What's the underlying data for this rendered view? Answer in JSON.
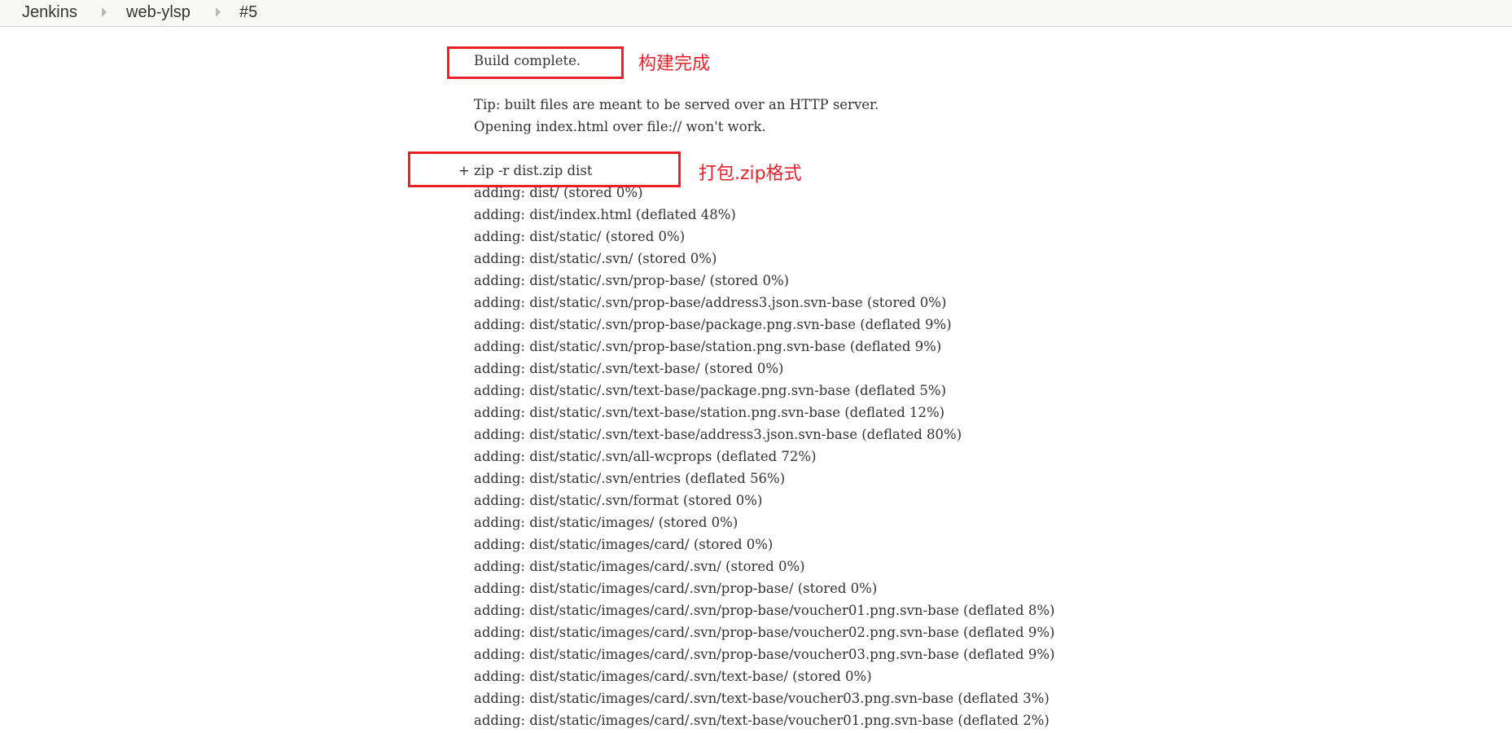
{
  "breadcrumb": {
    "items": [
      "Jenkins",
      "web-ylsp",
      "#5"
    ]
  },
  "console": {
    "build_complete": "Build complete.",
    "tip_lines": [
      "Tip: built files are meant to be served over an HTTP server.",
      "Opening index.html over file:// won't work."
    ],
    "zip_command": "+ zip -r dist.zip dist",
    "adding_lines": [
      "adding: dist/ (stored 0%)",
      "adding: dist/index.html (deflated 48%)",
      "adding: dist/static/ (stored 0%)",
      "adding: dist/static/.svn/ (stored 0%)",
      "adding: dist/static/.svn/prop-base/ (stored 0%)",
      "adding: dist/static/.svn/prop-base/address3.json.svn-base (stored 0%)",
      "adding: dist/static/.svn/prop-base/package.png.svn-base (deflated 9%)",
      "adding: dist/static/.svn/prop-base/station.png.svn-base (deflated 9%)",
      "adding: dist/static/.svn/text-base/ (stored 0%)",
      "adding: dist/static/.svn/text-base/package.png.svn-base (deflated 5%)",
      "adding: dist/static/.svn/text-base/station.png.svn-base (deflated 12%)",
      "adding: dist/static/.svn/text-base/address3.json.svn-base (deflated 80%)",
      "adding: dist/static/.svn/all-wcprops (deflated 72%)",
      "adding: dist/static/.svn/entries (deflated 56%)",
      "adding: dist/static/.svn/format (stored 0%)",
      "adding: dist/static/images/ (stored 0%)",
      "adding: dist/static/images/card/ (stored 0%)",
      "adding: dist/static/images/card/.svn/ (stored 0%)",
      "adding: dist/static/images/card/.svn/prop-base/ (stored 0%)",
      "adding: dist/static/images/card/.svn/prop-base/voucher01.png.svn-base (deflated 8%)",
      "adding: dist/static/images/card/.svn/prop-base/voucher02.png.svn-base (deflated 9%)",
      "adding: dist/static/images/card/.svn/prop-base/voucher03.png.svn-base (deflated 9%)",
      "adding: dist/static/images/card/.svn/text-base/ (stored 0%)",
      "adding: dist/static/images/card/.svn/text-base/voucher03.png.svn-base (deflated 3%)",
      "adding: dist/static/images/card/.svn/text-base/voucher01.png.svn-base (deflated 2%)"
    ]
  },
  "annotations": {
    "build_complete": "构建完成",
    "zip_package": "打包.zip格式"
  },
  "colors": {
    "highlight": "#e8212b",
    "console_text": "#333333",
    "breadcrumb_bg": "#f8f8f4"
  }
}
